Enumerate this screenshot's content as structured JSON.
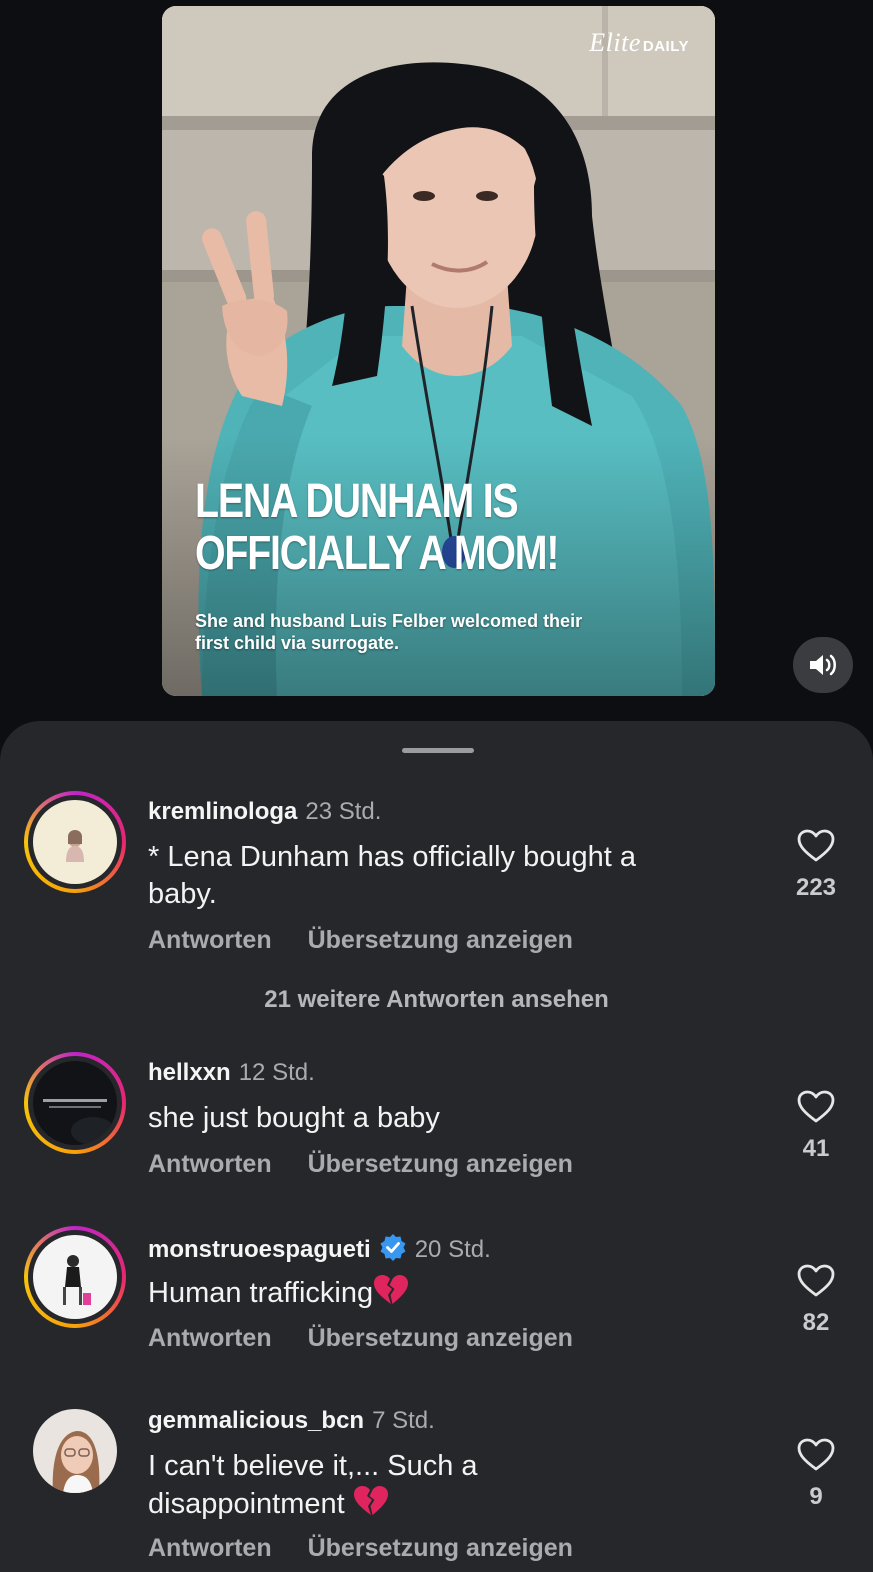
{
  "media": {
    "brand_italic": "Elite",
    "brand_bold": "DAILY",
    "headline_line1": "LENA DUNHAM IS",
    "headline_line2": "OFFICIALLY A MOM!",
    "subhead_line1": "She and husband Luis Felber welcomed their",
    "subhead_line2": "first child via surrogate.",
    "sound_icon": "speaker-icon"
  },
  "comments": [
    {
      "username": "kremlinologa",
      "time": "23 Std.",
      "text_line1": "* Lena Dunham has officially bought a",
      "text_line2": "baby.",
      "reply_label": "Antworten",
      "translate_label": "Übersetzung anzeigen",
      "likes": "223",
      "more_replies": "21 weitere Antworten ansehen",
      "story_ring": true
    },
    {
      "username": "hellxxn",
      "time": "12 Std.",
      "text_line1": "she just bought a baby",
      "reply_label": "Antworten",
      "translate_label": "Übersetzung anzeigen",
      "likes": "41",
      "story_ring": true
    },
    {
      "username": "monstruoespagueti",
      "time": "20 Std.",
      "verified": true,
      "text_line1": "Human trafficking",
      "emoji": "broken-heart",
      "reply_label": "Antworten",
      "translate_label": "Übersetzung anzeigen",
      "likes": "82",
      "story_ring": true
    },
    {
      "username": "gemmalicious_bcn",
      "time": "7 Std.",
      "text_line1": "I can't believe it,... Such a",
      "text_line2": "disappointment",
      "emoji": "broken-heart",
      "reply_label": "Antworten",
      "translate_label": "Übersetzung anzeigen",
      "likes": "9",
      "story_ring": false
    }
  ],
  "colors": {
    "background": "#0c0e12",
    "sheet": "#25272b",
    "muted_text": "#a9abae",
    "verified_blue": "#3897f0",
    "broken_heart": "#e0245e"
  }
}
